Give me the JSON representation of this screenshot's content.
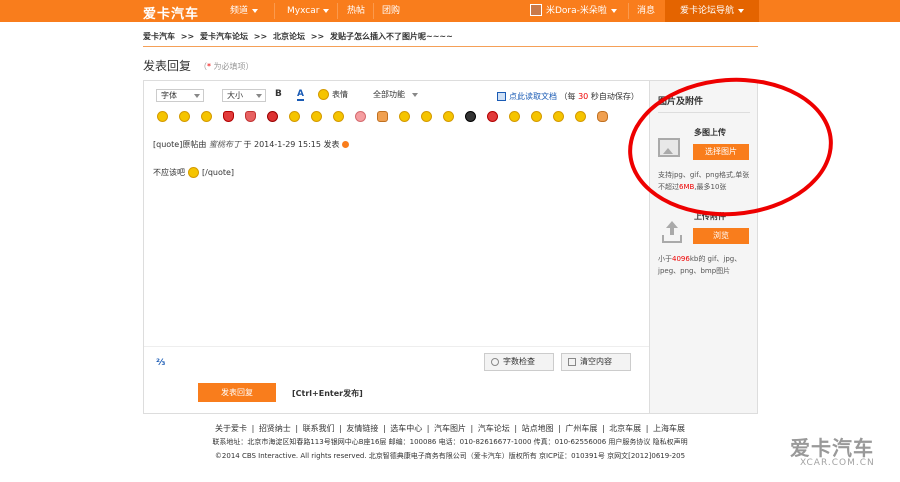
{
  "header": {
    "logo": "爱卡汽车",
    "nav": [
      "频道",
      "Myxcar",
      "热帖",
      "团购"
    ],
    "user": "米Dora-米朵啦",
    "messages": "消息",
    "forum_nav": "爱卡论坛导航"
  },
  "breadcrumb": [
    "爱卡汽车",
    ">>",
    "爱卡汽车论坛",
    ">>",
    "北京论坛",
    ">>",
    "发贴子怎么插入不了图片呢~~~~"
  ],
  "page": {
    "title": "发表回复",
    "required_note_open": "（",
    "required_star": "*",
    "required_note": "为必填项）"
  },
  "toolbar": {
    "font_label": "字体",
    "size_label": "大小",
    "bold": "B",
    "color": "A",
    "emoticon": "表情",
    "all_functions": "全部功能",
    "read_doc_link": "点此读取文档",
    "autosave_pre": "（每",
    "autosave_num": "30",
    "autosave_post": "秒自动保存）"
  },
  "editor": {
    "quote_prefix": "[quote]原帖由",
    "quote_author": "蜜桃布丁",
    "quote_mid": "于 2014-1-29 15:15 发表",
    "quote_body": "不应该吧",
    "quote_close": "[/quote]",
    "expand": "⅔"
  },
  "actions": {
    "word_check": "字数检查",
    "clear": "清空内容",
    "submit": "发表回复",
    "shortcut": "[Ctrl+Enter发布]"
  },
  "sidebar": {
    "title": "图片及附件",
    "multi_upload_title": "多图上传",
    "choose_button": "选择图片",
    "multi_desc_pre": "支持jpg、gif、png格式,单张不超过",
    "multi_desc_hl": "6MB",
    "multi_desc_post": ",最多10张",
    "upload_title": "上传附件",
    "browse_button": "浏览",
    "upload_desc_pre": "小于",
    "upload_desc_hl": "4096",
    "upload_desc_post": "kb的 gif、jpg、jpeg、png、bmp图片"
  },
  "footer": {
    "links": [
      "关于爱卡",
      "|",
      "招贤纳士",
      "|",
      "联系我们",
      "|",
      "友情链接",
      "|",
      "选车中心",
      "|",
      "汽车图片",
      "|",
      "汽车论坛",
      "|",
      "站点地图",
      "|",
      "广州车展",
      "|",
      "北京车展",
      "|",
      "上海车展"
    ],
    "address": "联系地址：北京市海淀区知春路113号银网中心B座16层 邮编：100086 电话：010-82616677-1000 传真：010-62556006 用户服务协议 隐私权声明",
    "copyright": "©2014 CBS Interactive. All rights reserved. 北京智德典康电子商务有限公司（爱卡汽车）版权所有 京ICP证：010391号 京网文[2012]0619-205"
  },
  "watermark": {
    "main": "爱卡汽车",
    "sub": "XCAR.COM.CN"
  },
  "colors": {
    "brand": "#f97d1c",
    "annotation": "#e00000"
  }
}
